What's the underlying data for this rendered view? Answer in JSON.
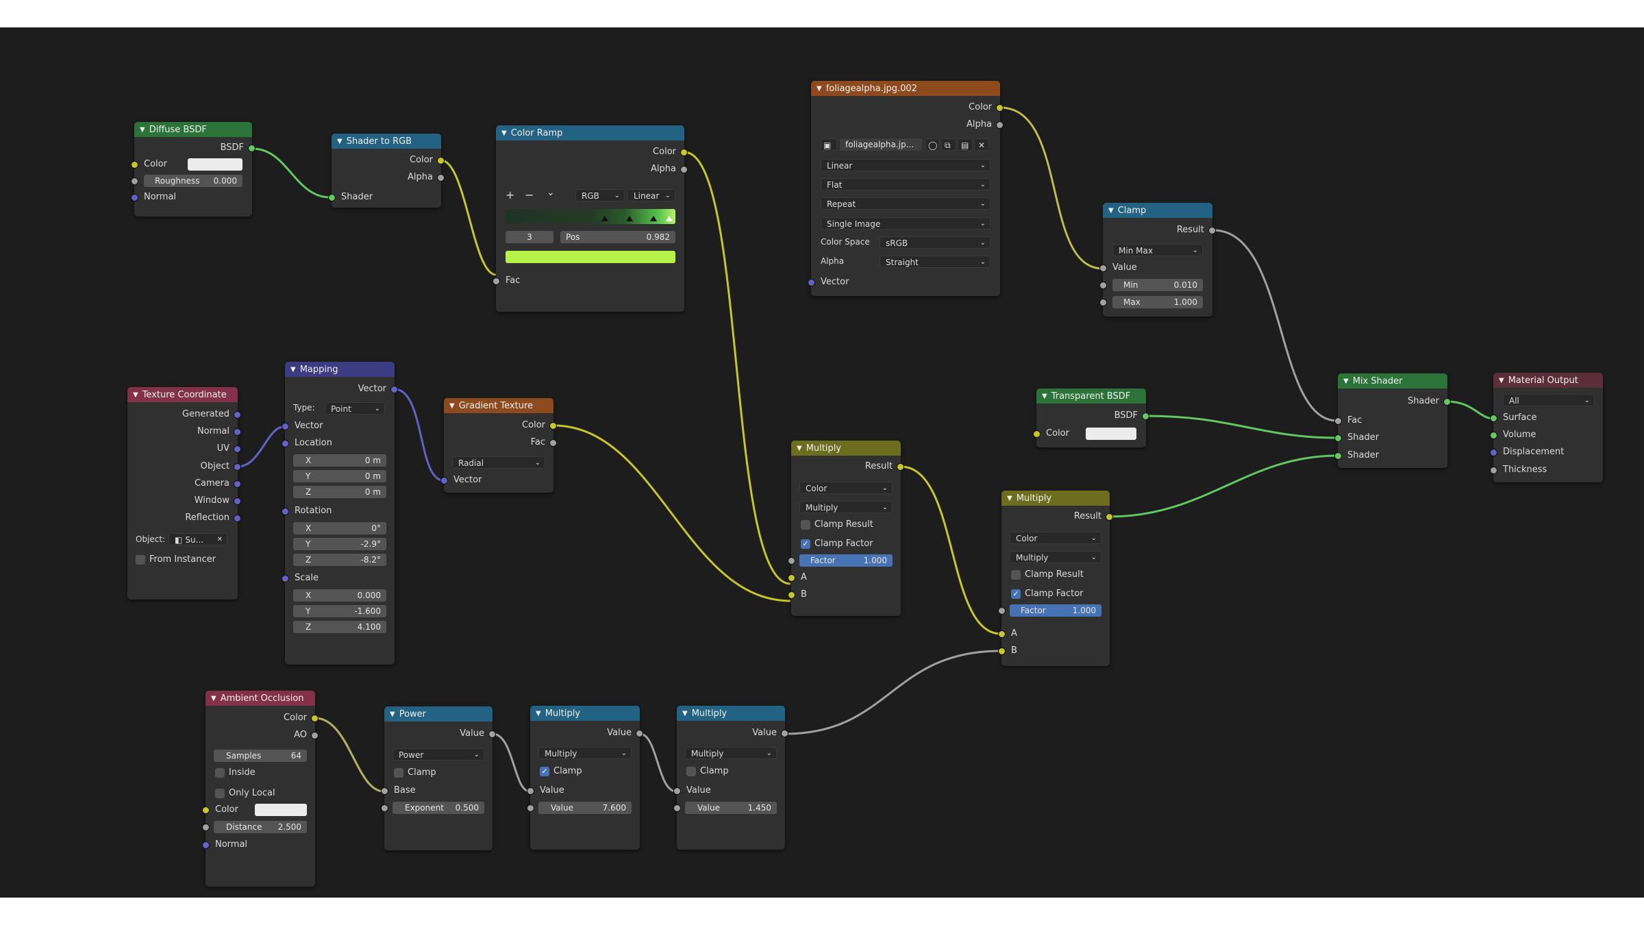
{
  "colors": {
    "hdr_shader": "#2c7339",
    "hdr_converter": "#246283",
    "hdr_vector": "#3c3c83",
    "hdr_input": "#83314a",
    "hdr_texture": "#8d4a1e",
    "hdr_color": "#6c6d1e",
    "hdr_output": "#5c2e3a",
    "canvas": "#1d1d1d",
    "node": "#303030",
    "wire_color": "#c7c729",
    "wire_gray": "#a1a1a1",
    "wire_vector": "#6363c7",
    "wire_shader": "#63c763"
  },
  "diffuse": {
    "title": "Diffuse BSDF",
    "out": "BSDF",
    "color": "Color",
    "roughness_label": "Roughness",
    "roughness": "0.000",
    "normal": "Normal"
  },
  "shader_to_rgb": {
    "title": "Shader to RGB",
    "color": "Color",
    "alpha": "Alpha",
    "shader": "Shader"
  },
  "color_ramp": {
    "title": "Color Ramp",
    "color": "Color",
    "alpha": "Alpha",
    "plus": "+",
    "minus": "−",
    "caret": "⌄",
    "mode": "RGB",
    "interp": "Linear",
    "index": "3",
    "pos_label": "Pos",
    "pos": "0.982",
    "fac": "Fac"
  },
  "image": {
    "title": "foliagealpha.jpg.002",
    "color": "Color",
    "alpha": "Alpha",
    "file": "foliagealpha.jp...",
    "interp": "Linear",
    "proj": "Flat",
    "ext": "Repeat",
    "source": "Single Image",
    "cs_label": "Color Space",
    "cs": "sRGB",
    "alpha_label": "Alpha",
    "alpha_mode": "Straight",
    "vector": "Vector"
  },
  "clamp": {
    "title": "Clamp",
    "result": "Result",
    "type": "Min Max",
    "value": "Value",
    "min_label": "Min",
    "min": "0.010",
    "max_label": "Max",
    "max": "1.000"
  },
  "texcoord": {
    "title": "Texture Coordinate",
    "generated": "Generated",
    "normal": "Normal",
    "uv": "UV",
    "object": "Object",
    "camera": "Camera",
    "window": "Window",
    "reflection": "Reflection",
    "object_label": "Object:",
    "object_value": "Su...",
    "from_instancer": "From Instancer"
  },
  "mapping": {
    "title": "Mapping",
    "vector_out": "Vector",
    "type_label": "Type:",
    "type": "Point",
    "vector_in": "Vector",
    "location": "Location",
    "lx": "0 m",
    "ly": "0 m",
    "lz": "0 m",
    "rotation": "Rotation",
    "rx": "0°",
    "ry": "-2.9°",
    "rz": "-8.2°",
    "scale": "Scale",
    "sx": "0.000",
    "sy": "-1.600",
    "sz": "4.100",
    "x": "X",
    "y": "Y",
    "z": "Z"
  },
  "gradient": {
    "title": "Gradient Texture",
    "color": "Color",
    "fac": "Fac",
    "type": "Radial",
    "vector": "Vector"
  },
  "multiply1": {
    "title": "Multiply",
    "result": "Result",
    "dtype": "Color",
    "blend": "Multiply",
    "clamp_result": "Clamp Result",
    "clamp_factor": "Clamp Factor",
    "factor_label": "Factor",
    "factor": "1.000",
    "a": "A",
    "b": "B"
  },
  "multiply2": {
    "title": "Multiply",
    "result": "Result",
    "dtype": "Color",
    "blend": "Multiply",
    "clamp_result": "Clamp Result",
    "clamp_factor": "Clamp Factor",
    "factor_label": "Factor",
    "factor": "1.000",
    "a": "A",
    "b": "B"
  },
  "transparent": {
    "title": "Transparent BSDF",
    "out": "BSDF",
    "color": "Color"
  },
  "mix": {
    "title": "Mix Shader",
    "out": "Shader",
    "fac": "Fac",
    "shader1": "Shader",
    "shader2": "Shader"
  },
  "output": {
    "title": "Material Output",
    "target": "All",
    "surface": "Surface",
    "volume": "Volume",
    "displacement": "Displacement",
    "thickness": "Thickness"
  },
  "ao": {
    "title": "Ambient Occlusion",
    "color": "Color",
    "ao": "AO",
    "samples_label": "Samples",
    "samples": "64",
    "inside": "Inside",
    "only_local": "Only Local",
    "color_in": "Color",
    "distance_label": "Distance",
    "distance": "2.500",
    "normal": "Normal"
  },
  "power": {
    "title": "Power",
    "value": "Value",
    "op": "Power",
    "clamp": "Clamp",
    "base": "Base",
    "exp_label": "Exponent",
    "exp": "0.500"
  },
  "math1": {
    "title": "Multiply",
    "value": "Value",
    "op": "Multiply",
    "clamp": "Clamp",
    "in": "Value",
    "val_label": "Value",
    "val": "7.600"
  },
  "math2": {
    "title": "Multiply",
    "value": "Value",
    "op": "Multiply",
    "clamp": "Clamp",
    "in": "Value",
    "val_label": "Value",
    "val": "1.450"
  },
  "icons": {
    "check": "✓",
    "chevron": "⌄",
    "close": "✕"
  }
}
